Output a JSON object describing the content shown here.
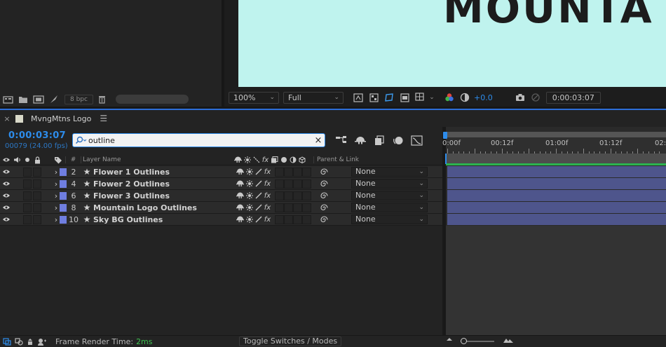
{
  "project": {
    "bpc_label": "8 bpc"
  },
  "viewer": {
    "comp_text": "MOUNTA",
    "zoom_value": "100%",
    "resolution_value": "Full",
    "exposure_value": "+0.0",
    "current_time": "0:00:03:07",
    "colors": {
      "canvas": "#bff3ee"
    }
  },
  "timeline": {
    "tab_title": "MvngMtns Logo",
    "timecode": "0:00:03:07",
    "frames_fps": "00079 (24.00 fps)",
    "search_value": "outline",
    "columns": {
      "number": "#",
      "layer_name": "Layer Name",
      "parent_link": "Parent & Link"
    },
    "layers": [
      {
        "number": "2",
        "name": "Flower 1 Outlines",
        "parent": "None"
      },
      {
        "number": "4",
        "name": "Flower 2 Outlines",
        "parent": "None"
      },
      {
        "number": "6",
        "name": "Flower 3 Outlines",
        "parent": "None"
      },
      {
        "number": "8",
        "name": "Mountain Logo Outlines",
        "parent": "None"
      },
      {
        "number": "10",
        "name": "Sky BG Outlines",
        "parent": "None"
      }
    ],
    "ruler_labels": [
      "0:00f",
      "00:12f",
      "01:00f",
      "01:12f",
      "02:"
    ],
    "colors": {
      "accent": "#2d8ceb",
      "layer_label": "#6f7ee0",
      "layer_bar": "#4e558c"
    }
  },
  "footer": {
    "render_label": "Frame Render Time:",
    "render_value": "2ms",
    "toggle_label": "Toggle Switches / Modes"
  }
}
